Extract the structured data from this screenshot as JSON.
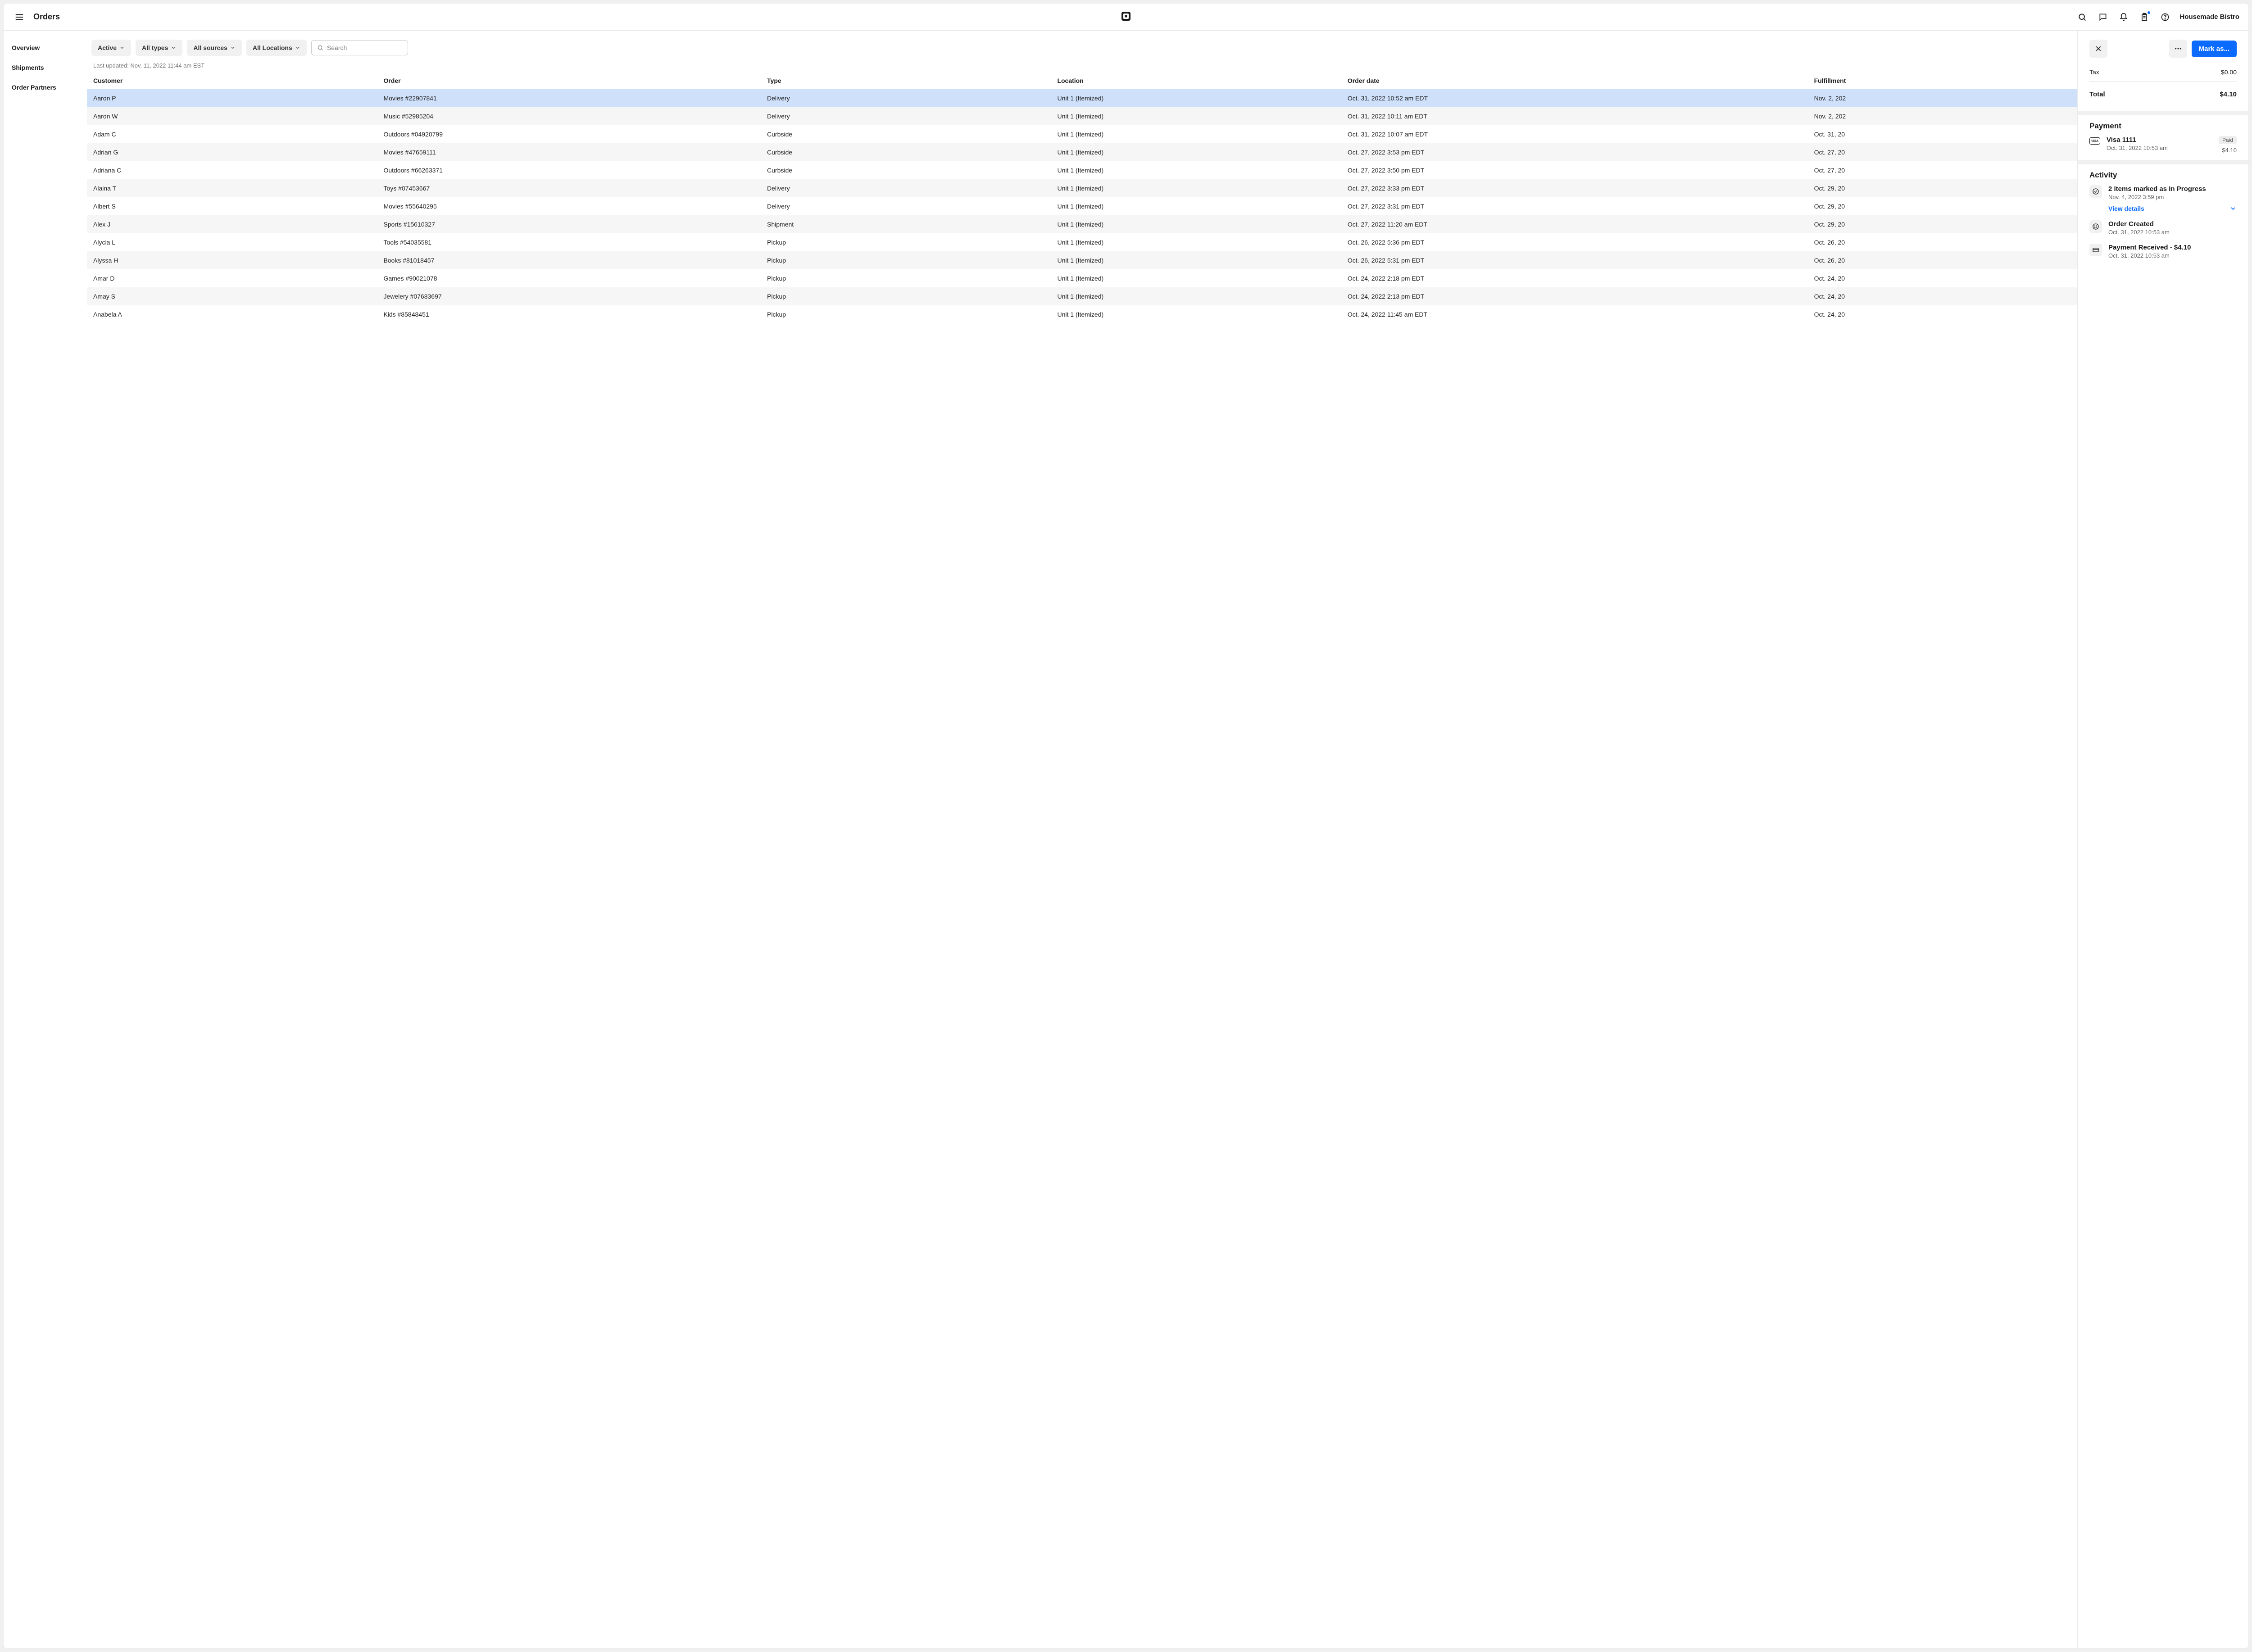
{
  "header": {
    "title": "Orders",
    "account": "Housemade Bistro"
  },
  "sidebar": {
    "items": [
      {
        "label": "Overview"
      },
      {
        "label": "Shipments"
      },
      {
        "label": "Order Partners"
      }
    ]
  },
  "filters": {
    "status": "Active",
    "types": "All types",
    "sources": "All sources",
    "locations": "All Locations",
    "search_placeholder": "Search"
  },
  "meta": {
    "last_updated": "Last updated: Nov. 11, 2022 11:44 am EST"
  },
  "table": {
    "headers": {
      "customer": "Customer",
      "order": "Order",
      "type": "Type",
      "location": "Location",
      "order_date": "Order date",
      "fulfillment": "Fulfillment"
    },
    "rows": [
      {
        "customer": "Aaron P",
        "order": "Movies #22907841",
        "type": "Delivery",
        "location": "Unit 1 (Itemized)",
        "date": "Oct. 31, 2022 10:52 am EDT",
        "fulfill": "Nov. 2, 202",
        "selected": true
      },
      {
        "customer": "Aaron W",
        "order": "Music #52985204",
        "type": "Delivery",
        "location": "Unit 1 (Itemized)",
        "date": "Oct. 31, 2022 10:11 am EDT",
        "fulfill": "Nov. 2, 202"
      },
      {
        "customer": "Adam C",
        "order": "Outdoors #04920799",
        "type": "Curbside",
        "location": "Unit 1 (Itemized)",
        "date": "Oct. 31, 2022 10:07 am EDT",
        "fulfill": "Oct. 31, 20"
      },
      {
        "customer": "Adrian G",
        "order": "Movies #47659111",
        "type": "Curbside",
        "location": "Unit 1 (Itemized)",
        "date": "Oct. 27, 2022 3:53 pm EDT",
        "fulfill": "Oct. 27, 20"
      },
      {
        "customer": "Adriana C",
        "order": "Outdoors #66263371",
        "type": "Curbside",
        "location": "Unit 1 (Itemized)",
        "date": "Oct. 27, 2022 3:50 pm EDT",
        "fulfill": "Oct. 27, 20"
      },
      {
        "customer": "Alaina T",
        "order": "Toys #07453667",
        "type": "Delivery",
        "location": "Unit 1 (Itemized)",
        "date": "Oct. 27, 2022 3:33 pm EDT",
        "fulfill": "Oct. 29, 20"
      },
      {
        "customer": "Albert S",
        "order": "Movies #55640295",
        "type": "Delivery",
        "location": "Unit 1 (Itemized)",
        "date": "Oct. 27, 2022 3:31 pm EDT",
        "fulfill": "Oct. 29, 20",
        "altwhite": true
      },
      {
        "customer": "Alex J",
        "order": "Sports #15610327",
        "type": "Shipment",
        "location": "Unit 1 (Itemized)",
        "date": "Oct. 27, 2022 11:20 am EDT",
        "fulfill": "Oct. 29, 20"
      },
      {
        "customer": "Alycia L",
        "order": "Tools #54035581",
        "type": "Pickup",
        "location": "Unit 1 (Itemized)",
        "date": "Oct. 26, 2022 5:36 pm EDT",
        "fulfill": "Oct. 26, 20"
      },
      {
        "customer": "Alyssa H",
        "order": "Books #81018457",
        "type": "Pickup",
        "location": "Unit 1 (Itemized)",
        "date": "Oct. 26, 2022 5:31 pm EDT",
        "fulfill": "Oct. 26, 20"
      },
      {
        "customer": "Amar D",
        "order": "Games #90021078",
        "type": "Pickup",
        "location": "Unit 1 (Itemized)",
        "date": "Oct. 24, 2022 2:18 pm EDT",
        "fulfill": "Oct. 24, 20"
      },
      {
        "customer": "Amay S",
        "order": "Jewelery #07683697",
        "type": "Pickup",
        "location": "Unit 1 (Itemized)",
        "date": "Oct. 24, 2022 2:13 pm EDT",
        "fulfill": "Oct. 24, 20"
      },
      {
        "customer": "Anabela A",
        "order": "Kids #85848451",
        "type": "Pickup",
        "location": "Unit 1 (Itemized)",
        "date": "Oct. 24, 2022 11:45 am EDT",
        "fulfill": "Oct. 24, 20"
      }
    ]
  },
  "detail": {
    "mark_as": "Mark as...",
    "tax_label": "Tax",
    "tax_value": "$0.00",
    "total_label": "Total",
    "total_value": "$4.10",
    "payment_section": "Payment",
    "payment": {
      "card": "Visa 1111",
      "timestamp": "Oct. 31, 2022 10:53 am",
      "status": "Paid",
      "amount": "$4.10",
      "card_brand": "VISA"
    },
    "activity_section": "Activity",
    "activities": [
      {
        "title": "2 items marked as In Progress",
        "timestamp": "Nov. 4, 2022 3:59 pm",
        "has_details": true,
        "details_label": "View details",
        "icon": "check"
      },
      {
        "title": "Order Created",
        "timestamp": "Oct. 31, 2022 10:53 am",
        "icon": "smile"
      },
      {
        "title": "Payment Received - $4.10",
        "timestamp": "Oct. 31, 2022 10:53 am",
        "icon": "card"
      }
    ]
  }
}
